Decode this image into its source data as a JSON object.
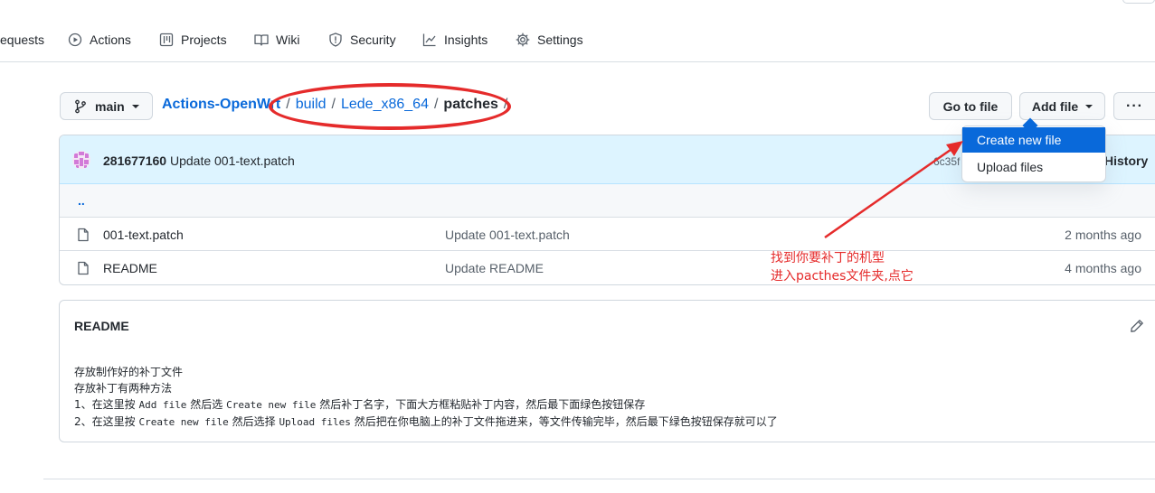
{
  "nav": {
    "items": [
      {
        "label": "equests",
        "icon": "pull-request-icon"
      },
      {
        "label": "Actions",
        "icon": "play-icon"
      },
      {
        "label": "Projects",
        "icon": "table-icon"
      },
      {
        "label": "Wiki",
        "icon": "book-icon"
      },
      {
        "label": "Security",
        "icon": "shield-icon"
      },
      {
        "label": "Insights",
        "icon": "graph-icon"
      },
      {
        "label": "Settings",
        "icon": "gear-icon"
      }
    ]
  },
  "branch": {
    "label": "main"
  },
  "breadcrumb": {
    "repo": "Actions-OpenWrt",
    "sep": "/",
    "parts": [
      "build",
      "Lede_x86_64"
    ],
    "current": "patches"
  },
  "toolbar": {
    "go_to_file": "Go to file",
    "add_file": "Add file",
    "more": "···"
  },
  "dropdown": {
    "items": [
      "Create new file",
      "Upload files"
    ]
  },
  "commit": {
    "author": "281677160",
    "message": "Update 001-text.patch",
    "sha": "6c35f",
    "history": "History"
  },
  "files": {
    "up": "..",
    "rows": [
      {
        "name": "001-text.patch",
        "message": "Update 001-text.patch",
        "age": "2 months ago"
      },
      {
        "name": "README",
        "message": "Update README",
        "age": "4 months ago"
      }
    ]
  },
  "annotation": {
    "line1": "找到你要补丁的机型",
    "line2": "进入pacthes文件夹,点它",
    "color": "#e52b2b"
  },
  "readme": {
    "title": "README",
    "line1": "存放制作好的补丁文件",
    "line2": "存放补丁有两种方法",
    "line3_a": "1、在这里按 ",
    "line3_b": "Add file",
    "line3_c": " 然后选 ",
    "line3_d": "Create new file",
    "line3_e": " 然后补丁名字，下面大方框粘贴补丁内容，然后最下面绿色按钮保存",
    "line4_a": "2、在这里按 ",
    "line4_b": "Create new file",
    "line4_c": " 然后选择 ",
    "line4_d": "Upload files",
    "line4_e": " 然后把在你电脑上的补丁文件拖进来，等文件传输完毕，然后最下绿色按钮保存就可以了"
  },
  "colors": {
    "link": "#0969da",
    "accent": "#e52b2b"
  }
}
